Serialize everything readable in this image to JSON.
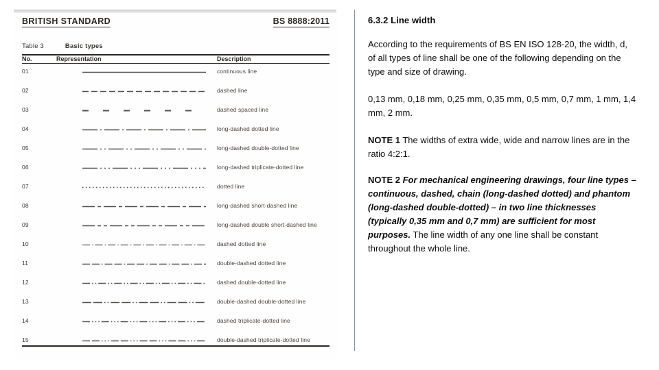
{
  "scan": {
    "header": {
      "title": "BRITISH STANDARD",
      "code": "BS 8888:2011"
    },
    "table": {
      "caption_number": "Table 3",
      "caption_text": "Basic types",
      "columns": {
        "no": "No.",
        "representation": "Representation",
        "description": "Description"
      },
      "rows": [
        {
          "no": "01",
          "description": "continuous line",
          "pattern": "solid"
        },
        {
          "no": "02",
          "description": "dashed line",
          "pattern": "dashed"
        },
        {
          "no": "03",
          "description": "dashed spaced line",
          "pattern": "dashed-spaced"
        },
        {
          "no": "04",
          "description": "long-dashed dotted line",
          "pattern": "long-dash-dot"
        },
        {
          "no": "05",
          "description": "long-dashed double-dotted line",
          "pattern": "long-dash-double-dot"
        },
        {
          "no": "06",
          "description": "long-dashed triplicate-dotted line",
          "pattern": "long-dash-triple-dot"
        },
        {
          "no": "07",
          "description": "dotted line",
          "pattern": "dotted"
        },
        {
          "no": "08",
          "description": "long-dashed short-dashed line",
          "pattern": "long-dash-short-dash"
        },
        {
          "no": "09",
          "description": "long-dashed double short-dashed line",
          "pattern": "long-dash-double-short-dash"
        },
        {
          "no": "10",
          "description": "dashed dotted line",
          "pattern": "dash-dot"
        },
        {
          "no": "11",
          "description": "double-dashed dotted line",
          "pattern": "double-dash-dot"
        },
        {
          "no": "12",
          "description": "dashed double-dotted line",
          "pattern": "dash-double-dot"
        },
        {
          "no": "13",
          "description": "double-dashed double-dotted line",
          "pattern": "double-dash-double-dot"
        },
        {
          "no": "14",
          "description": "dashed triplicate-dotted line",
          "pattern": "dash-triple-dot"
        },
        {
          "no": "15",
          "description": "double-dashed triplicate-dotted line",
          "pattern": "double-dash-triple-dot"
        }
      ]
    }
  },
  "body": {
    "section_heading": "6.3.2 Line width",
    "intro": "According to the requirements of BS EN ISO 128-20, the width, d, of all types of line shall be one of the following depending on the type and size of drawing.",
    "widths": "0,13 mm, 0,18 mm, 0,25 mm, 0,35 mm, 0,5 mm, 0,7 mm, 1 mm, 1,4 mm, 2 mm.",
    "note1_label": "NOTE 1",
    "note1_text": " The widths of extra wide, wide and narrow lines are in the ratio 4:2:1.",
    "note2_label": "NOTE 2",
    "note2_emphasis": " For mechanical engineering drawings, four line types – continuous, dashed, chain (long-dashed dotted) and phantom (long-dashed double-dotted) – in two line thicknesses (typically 0,35 mm and 0,7 mm) are sufficient for most purposes.",
    "note2_rest": " The line width of any one line shall be constant throughout the whole line."
  },
  "colors": {
    "divider": "#7d9aac",
    "scan_ink": "#2a2724",
    "body_text": "#0d0d0d"
  }
}
